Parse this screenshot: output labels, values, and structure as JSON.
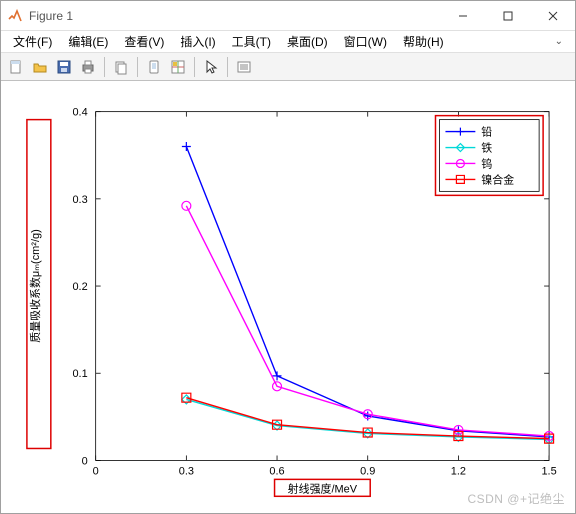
{
  "window": {
    "title": "Figure 1",
    "min_label": "—",
    "max_label": "☐",
    "close_label": "✕"
  },
  "menubar": {
    "items": [
      {
        "label": "文件(F)"
      },
      {
        "label": "编辑(E)"
      },
      {
        "label": "查看(V)"
      },
      {
        "label": "插入(I)"
      },
      {
        "label": "工具(T)"
      },
      {
        "label": "桌面(D)"
      },
      {
        "label": "窗口(W)"
      },
      {
        "label": "帮助(H)"
      }
    ],
    "right_glyph": "⌄"
  },
  "toolbar": {
    "icons": [
      "new",
      "open",
      "save",
      "print",
      "sep",
      "copy",
      "sep",
      "device",
      "grid",
      "sep",
      "cursor",
      "sep",
      "list"
    ]
  },
  "chart_data": {
    "type": "line",
    "x": [
      0.3,
      0.6,
      0.9,
      1.2,
      1.5
    ],
    "series": [
      {
        "name": "铅",
        "color": "#0000ff",
        "marker": "plus",
        "values": [
          0.36,
          0.097,
          0.051,
          0.034,
          0.027
        ]
      },
      {
        "name": "铁",
        "color": "#00d8d8",
        "marker": "diamond",
        "values": [
          0.07,
          0.04,
          0.031,
          0.027,
          0.024
        ]
      },
      {
        "name": "钨",
        "color": "#ff00ff",
        "marker": "circle",
        "values": [
          0.292,
          0.085,
          0.053,
          0.035,
          0.028
        ]
      },
      {
        "name": "镍合金",
        "color": "#ff0000",
        "marker": "square",
        "values": [
          0.072,
          0.041,
          0.032,
          0.028,
          0.025
        ]
      }
    ],
    "title": "",
    "xlabel": "射线强度/MeV",
    "ylabel": "质量吸收系数μₘ(cm²/g)",
    "xlim": [
      0,
      1.5
    ],
    "ylim": [
      0,
      0.4
    ],
    "xticks": [
      0,
      0.3,
      0.6,
      0.9,
      1.2,
      1.5
    ],
    "yticks": [
      0,
      0.1,
      0.2,
      0.3,
      0.4
    ],
    "legend_position": "top-right"
  },
  "watermark": "CSDN @+记绝尘"
}
